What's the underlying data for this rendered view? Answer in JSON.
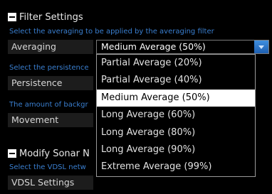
{
  "filter_settings": {
    "title": "Filter Settings",
    "averaging_description": "Select the averaging to be applied by the averaging filter",
    "averaging_label": "Averaging",
    "averaging_selected": "Medium Average (50%)",
    "persistence_description": "Select the persistence",
    "persistence_label": "Persistence",
    "movement_description": "The amount of backgr",
    "movement_label": "Movement"
  },
  "modify_sonar": {
    "title": "Modify Sonar N",
    "vdsl_description": "Select the VDSL netw",
    "vdsl_label": "VDSL Settings"
  },
  "averaging_dropdown": {
    "options": [
      "Partial Average (20%)",
      "Partial Average (40%)",
      "Medium Average (50%)",
      "Long Average (60%)",
      "Long Average (80%)",
      "Long Average (90%)",
      "Extreme Average (99%)"
    ],
    "selected_index": 2
  },
  "colors": {
    "background": "#000000",
    "description_text": "#3a7fd0",
    "label_box": "#1c1c1c",
    "selected_option_bg": "#ffffff",
    "arrow_button": "#2f7ad0"
  }
}
